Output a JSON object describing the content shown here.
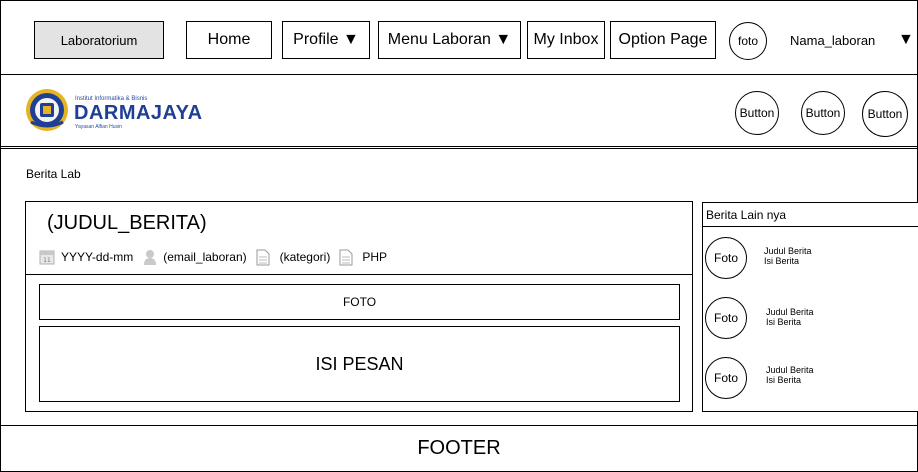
{
  "nav": {
    "lab_label": "Laboratorium",
    "home_label": "Home",
    "profile_label": "Profile ▼",
    "menu_laboran_label": "Menu Laboran ▼",
    "inbox_label": "My Inbox",
    "option_label": "Option Page",
    "avatar_label": "foto",
    "user_name": "Nama_laboran",
    "caret": "▼"
  },
  "header": {
    "logo_top": "Institut Informatika & Bisnis",
    "logo_name": "DARMAJAYA",
    "logo_sub": "Yayasan Alfian Husin",
    "buttons": [
      "Button",
      "Button",
      "Button"
    ]
  },
  "page": {
    "section_title": "Berita Lab"
  },
  "article": {
    "title": "(JUDUL_BERITA)",
    "date": "YYYY-dd-mm",
    "email": "(email_laboran)",
    "category": "(kategori)",
    "tag": "PHP",
    "photo_label": "FOTO",
    "content_label": "ISI PESAN"
  },
  "sidebar": {
    "title": "Berita Lain nya",
    "items": [
      {
        "photo": "Foto",
        "title": "Judul Berita",
        "body": "Isi Berita"
      },
      {
        "photo": "Foto",
        "title": "Judul Berita",
        "body": "Isi Berita"
      },
      {
        "photo": "Foto",
        "title": "Judul Berita",
        "body": "Isi Berita"
      }
    ]
  },
  "footer": {
    "label": "FOOTER"
  }
}
